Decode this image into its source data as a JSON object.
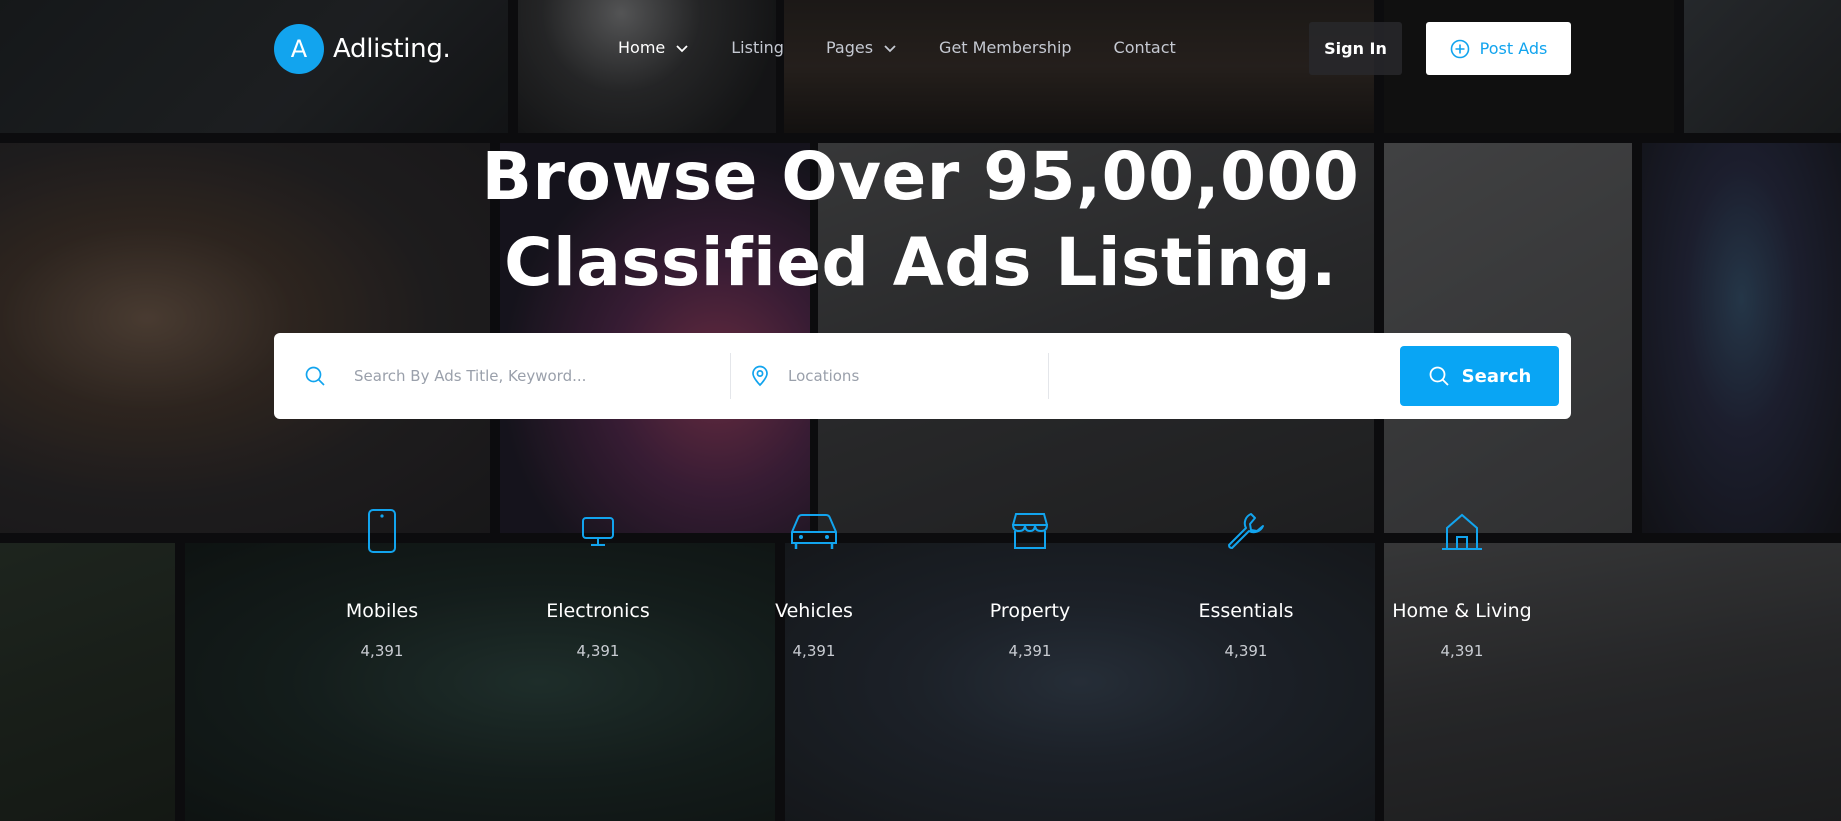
{
  "brand": {
    "logo_letter": "A",
    "name": "Adlisting.",
    "accent_color": "#12a4ee"
  },
  "nav": {
    "items": [
      {
        "label": "Home",
        "active": true,
        "has_dropdown": true
      },
      {
        "label": "Listing",
        "active": false,
        "has_dropdown": false
      },
      {
        "label": "Pages",
        "active": false,
        "has_dropdown": true
      },
      {
        "label": "Get Membership",
        "active": false,
        "has_dropdown": false
      },
      {
        "label": "Contact",
        "active": false,
        "has_dropdown": false
      }
    ],
    "signin_label": "Sign In",
    "post_ads_label": "Post Ads"
  },
  "hero": {
    "title_line1": "Browse Over 95,00,000",
    "title_line2": "Classified Ads Listing."
  },
  "search": {
    "keyword_placeholder": "Search By Ads Title, Keyword...",
    "location_placeholder": "Locations",
    "button_label": "Search",
    "button_color": "#09a5f4"
  },
  "categories": [
    {
      "name": "Mobiles",
      "count": "4,391",
      "icon": "mobile-icon"
    },
    {
      "name": "Electronics",
      "count": "4,391",
      "icon": "monitor-icon"
    },
    {
      "name": "Vehicles",
      "count": "4,391",
      "icon": "car-icon"
    },
    {
      "name": "Property",
      "count": "4,391",
      "icon": "store-icon"
    },
    {
      "name": "Essentials",
      "count": "4,391",
      "icon": "wrench-icon"
    },
    {
      "name": "Home & Living",
      "count": "4,391",
      "icon": "house-icon"
    }
  ]
}
